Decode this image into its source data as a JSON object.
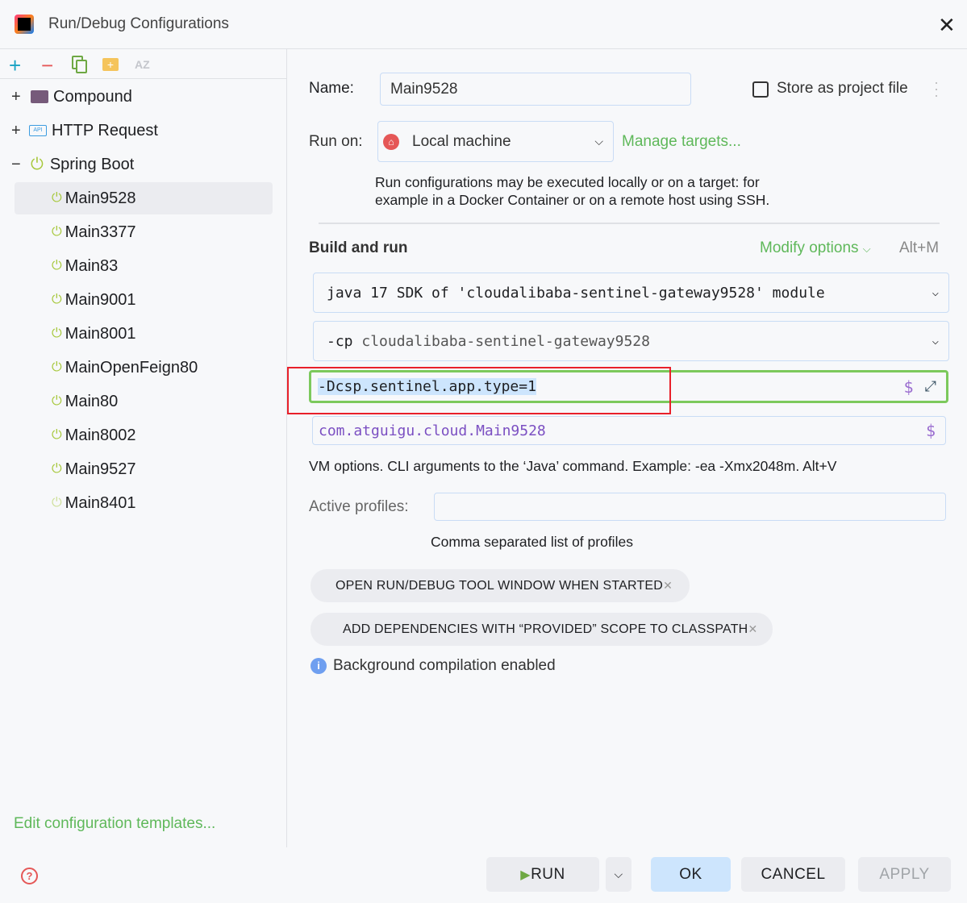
{
  "window": {
    "title": "Run/Debug Configurations",
    "close": "✕"
  },
  "toolbar": {
    "add": "+",
    "remove": "−",
    "az": "AZ"
  },
  "tree": {
    "groups": [
      {
        "label": "Compound",
        "expander": "+"
      },
      {
        "label": "HTTP Request",
        "expander": "+"
      },
      {
        "label": "Spring Boot",
        "expander": "−"
      }
    ],
    "items": [
      "Main9528",
      "Main3377",
      "Main83",
      "Main9001",
      "Main8001",
      "MainOpenFeign80",
      "Main80",
      "Main8002",
      "Main9527",
      "Main8401"
    ],
    "selected": "Main9528"
  },
  "edit_templates": "Edit configuration templates...",
  "form": {
    "name_label": "Name:",
    "name_value": "Main9528",
    "store_label": "Store as project file",
    "store_checked": false,
    "runon_label": "Run on:",
    "runon_value": "Local machine",
    "manage_targets": "Manage targets...",
    "runon_desc1": "Run configurations may be executed locally or on a target: for",
    "runon_desc2": "example in a Docker Container or on a remote host using SSH.",
    "build_run": "Build and run",
    "modify_options": "Modify options",
    "modify_shortcut": "Alt+M",
    "jdk": "java 17 SDK of 'cloudalibaba-sentinel-gateway9528' module",
    "cp_flag": "-cp",
    "cp_value": "cloudalibaba-sentinel-gateway9528",
    "vm_options": "-Dcsp.sentinel.app.type=1",
    "main_class": "com.atguigu.cloud.Main9528",
    "vm_hint": "VM options. CLI arguments to the ‘Java’ command. Example: -ea -Xmx2048m. Alt+V",
    "profiles_label": "Active profiles:",
    "profiles_value": "",
    "profiles_hint": "Comma separated list of profiles",
    "chips": [
      "OPEN RUN/DEBUG TOOL WINDOW WHEN STARTED",
      "ADD DEPENDENCIES WITH “PROVIDED” SCOPE TO CLASSPATH"
    ],
    "info": "Background compilation enabled",
    "dollar": "$"
  },
  "buttons": {
    "run": "RUN",
    "ok": "OK",
    "cancel": "CANCEL",
    "apply": "APPLY"
  },
  "colors": {
    "accent_green": "#5fb85a",
    "highlight_red": "#e8202a",
    "focus_green": "#7cc95c",
    "primary_button": "#cde5fd"
  }
}
